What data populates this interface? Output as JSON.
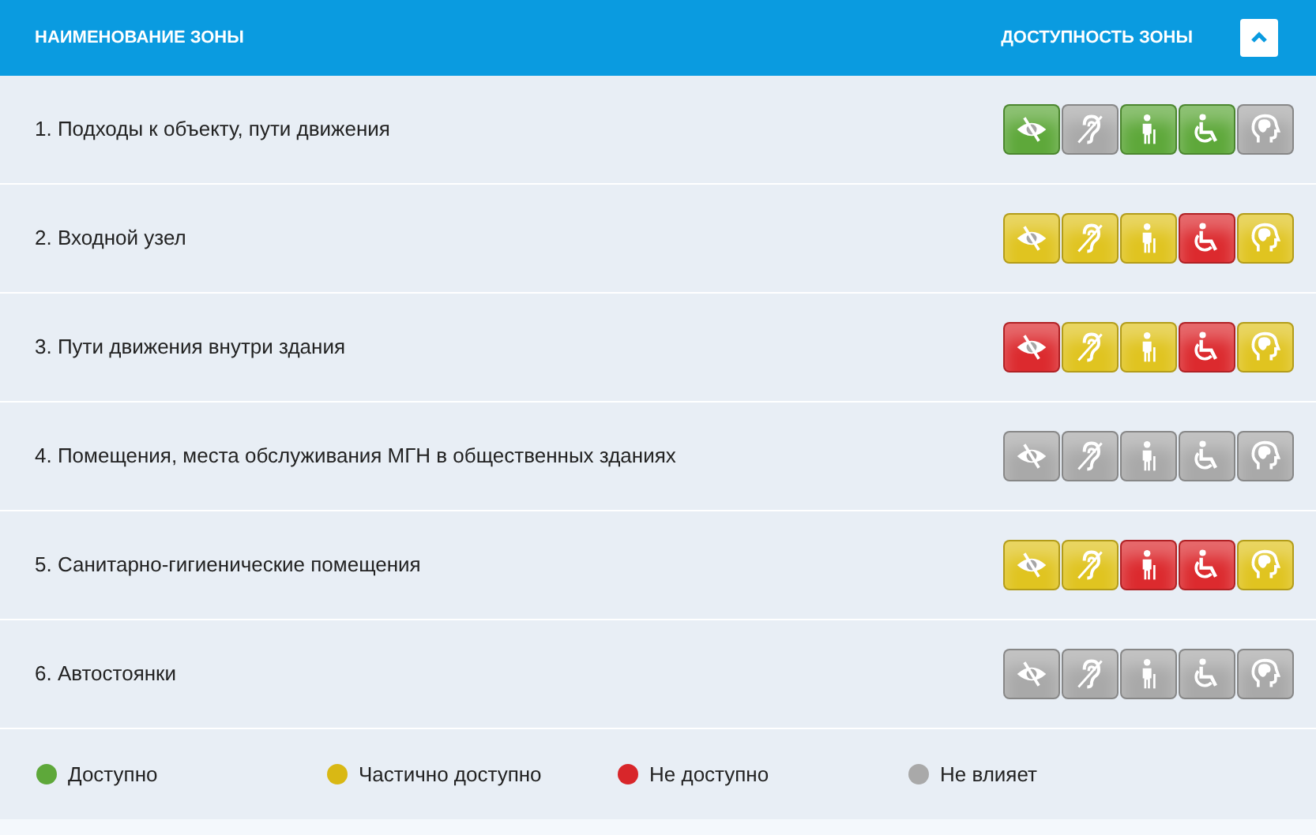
{
  "header": {
    "name_column": "НАИМЕНОВАНИЕ ЗОНЫ",
    "access_column": "ДОСТУПНОСТЬ ЗОНЫ",
    "expanded": true
  },
  "zones": [
    {
      "name": "1. Подходы к объекту, пути движения",
      "badges": [
        {
          "kind": "vision",
          "color": "#5ea83a"
        },
        {
          "kind": "hearing",
          "color": "#a9a9a9"
        },
        {
          "kind": "mobility",
          "color": "#5ea83a"
        },
        {
          "kind": "wheelchair",
          "color": "#5ea83a"
        },
        {
          "kind": "mental",
          "color": "#a9a9a9"
        }
      ]
    },
    {
      "name": "2. Входной узел",
      "badges": [
        {
          "kind": "vision",
          "color": "#e0c420"
        },
        {
          "kind": "hearing",
          "color": "#e0c420"
        },
        {
          "kind": "mobility",
          "color": "#e0c420"
        },
        {
          "kind": "wheelchair",
          "color": "#dc2a2e"
        },
        {
          "kind": "mental",
          "color": "#e0c420"
        }
      ]
    },
    {
      "name": "3. Пути движения внутри здания",
      "badges": [
        {
          "kind": "vision",
          "color": "#dc2a2e"
        },
        {
          "kind": "hearing",
          "color": "#e0c420"
        },
        {
          "kind": "mobility",
          "color": "#e0c420"
        },
        {
          "kind": "wheelchair",
          "color": "#dc2a2e"
        },
        {
          "kind": "mental",
          "color": "#e0c420"
        }
      ]
    },
    {
      "name": "4. Помещения, места обслуживания МГН в общественных зданиях",
      "badges": [
        {
          "kind": "vision",
          "color": "#a9a9a9"
        },
        {
          "kind": "hearing",
          "color": "#a9a9a9"
        },
        {
          "kind": "mobility",
          "color": "#a9a9a9"
        },
        {
          "kind": "wheelchair",
          "color": "#a9a9a9"
        },
        {
          "kind": "mental",
          "color": "#a9a9a9"
        }
      ]
    },
    {
      "name": "5. Санитарно-гигиенические помещения",
      "badges": [
        {
          "kind": "vision",
          "color": "#e0c420"
        },
        {
          "kind": "hearing",
          "color": "#e0c420"
        },
        {
          "kind": "mobility",
          "color": "#dc2a2e"
        },
        {
          "kind": "wheelchair",
          "color": "#dc2a2e"
        },
        {
          "kind": "mental",
          "color": "#e0c420"
        }
      ]
    },
    {
      "name": "6. Автостоянки",
      "badges": [
        {
          "kind": "vision",
          "color": "#a9a9a9"
        },
        {
          "kind": "hearing",
          "color": "#a9a9a9"
        },
        {
          "kind": "mobility",
          "color": "#a9a9a9"
        },
        {
          "kind": "wheelchair",
          "color": "#a9a9a9"
        },
        {
          "kind": "mental",
          "color": "#a9a9a9"
        }
      ]
    }
  ],
  "legend": [
    {
      "label": "Доступно",
      "color": "#5ea83a"
    },
    {
      "label": "Частично доступно",
      "color": "#d9b814"
    },
    {
      "label": "Не доступно",
      "color": "#d8262a"
    },
    {
      "label": "Не влияет",
      "color": "#a9a9a9"
    }
  ]
}
